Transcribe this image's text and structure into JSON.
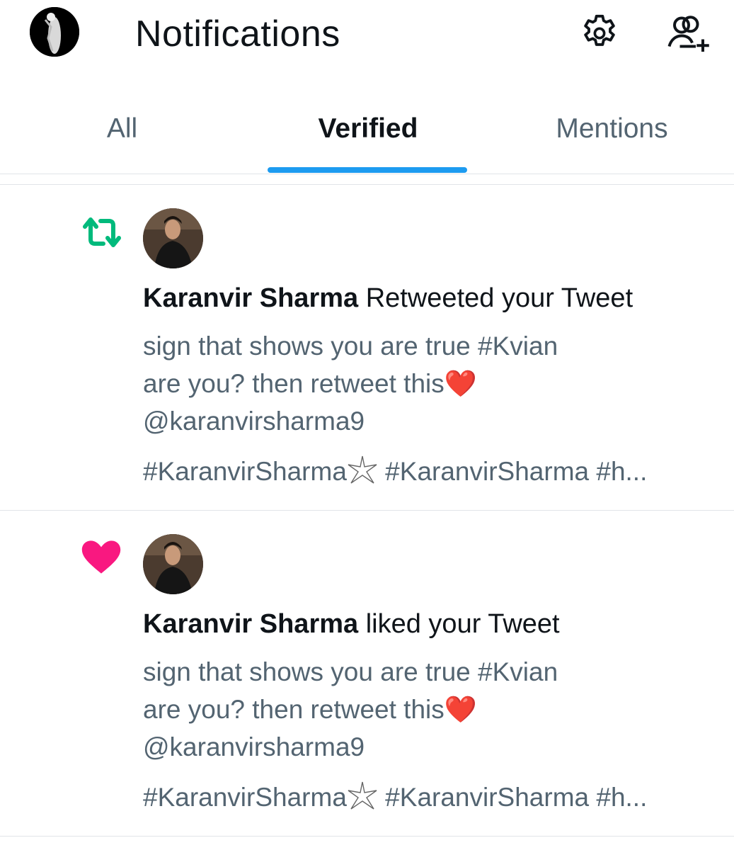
{
  "header": {
    "title": "Notifications",
    "icons": {
      "profile": "profile-avatar",
      "settings": "gear-icon",
      "follow": "add-people-icon"
    }
  },
  "tabs": [
    {
      "label": "All",
      "active": false
    },
    {
      "label": "Verified",
      "active": true
    },
    {
      "label": "Mentions",
      "active": false
    }
  ],
  "colors": {
    "accent": "#1d9bf0",
    "retweet": "#00ba7c",
    "like": "#f91880",
    "text": "#0f1419",
    "secondary": "#536471"
  },
  "notifications": [
    {
      "type_icon": "retweet-icon",
      "actor": "Karanvir Sharma",
      "action": "Retweeted your Tweet",
      "tweet_line1": "sign that shows you are true #Kvian",
      "tweet_line2": "are you? then retweet this",
      "tweet_emoji": "❤️",
      "mention": "@karanvirsharma9",
      "tags_start": "#KaranvirSharma",
      "tags_end": " #KaranvirSharma #h..."
    },
    {
      "type_icon": "heart-icon",
      "actor": "Karanvir Sharma",
      "action": "liked your Tweet",
      "tweet_line1": "sign that shows you are true #Kvian",
      "tweet_line2": "are you? then retweet this",
      "tweet_emoji": "❤️",
      "mention": "@karanvirsharma9",
      "tags_start": "#KaranvirSharma",
      "tags_end": " #KaranvirSharma #h..."
    }
  ]
}
